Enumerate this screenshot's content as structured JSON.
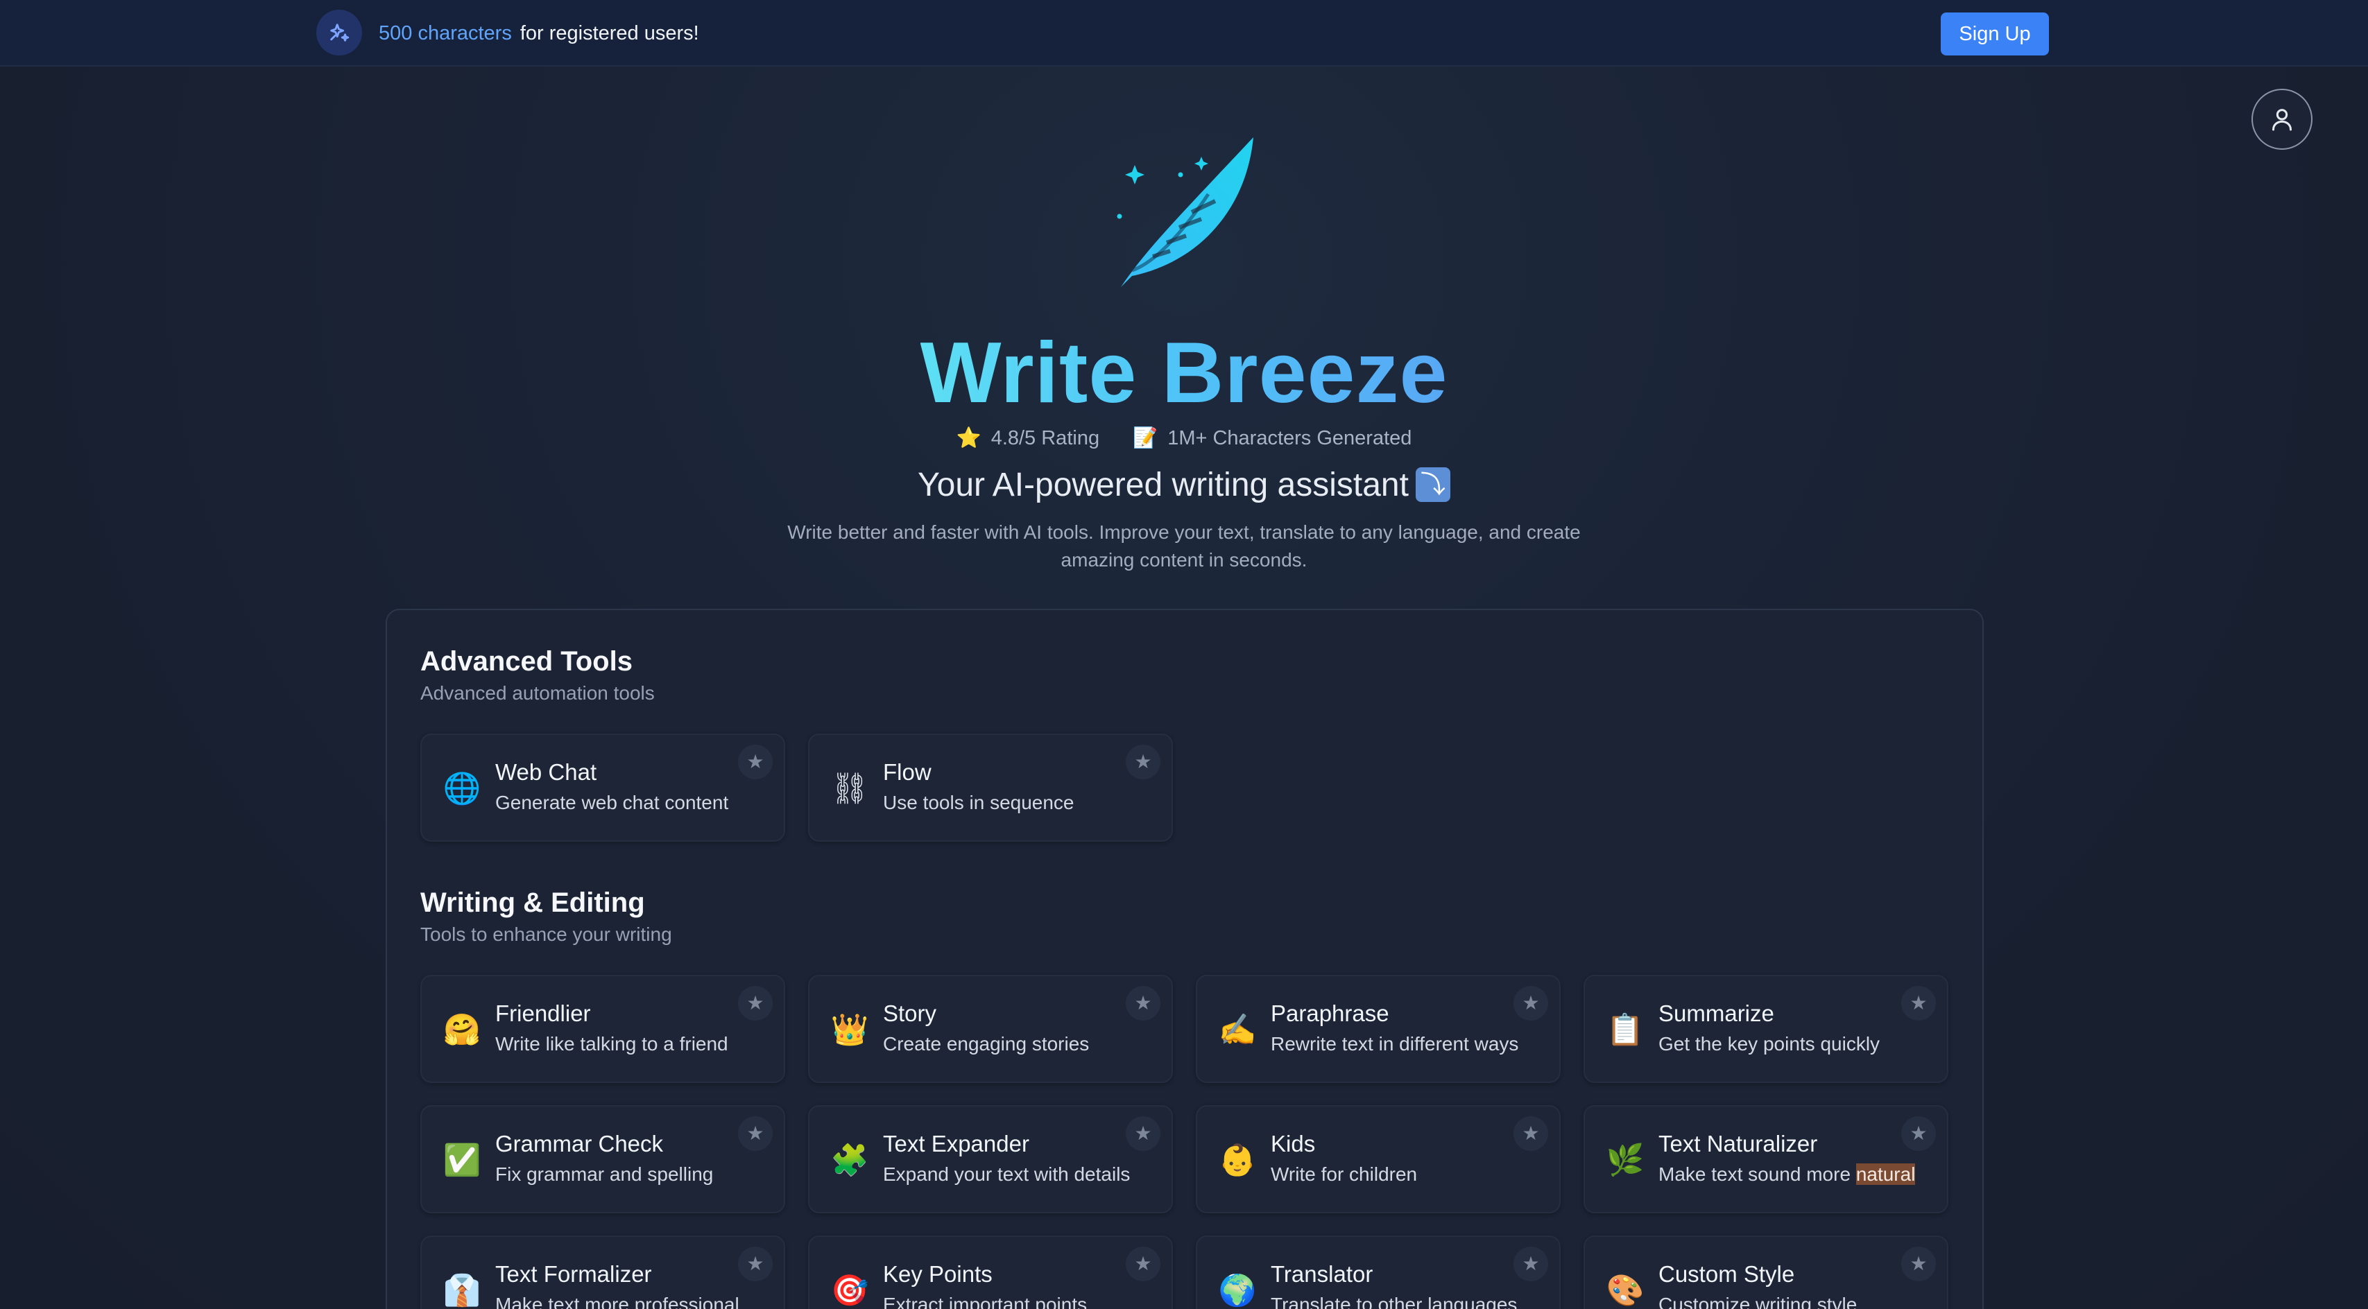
{
  "banner": {
    "highlight": "500 characters",
    "text": "for registered users!",
    "signup_label": "Sign Up",
    "icon": "sparkles-icon"
  },
  "user": {
    "icon": "user-icon"
  },
  "hero": {
    "brand": "Write Breeze",
    "rating_icon": "⭐",
    "rating": "4.8/5 Rating",
    "chars_icon": "📝",
    "chars": "1M+ Characters Generated",
    "tagline": "Your AI-powered writing assistant",
    "tagline_emoji": "⤵",
    "description": "Write better and faster with AI tools. Improve your text, translate to any language, and create amazing content in seconds."
  },
  "sections": {
    "advanced": {
      "title": "Advanced Tools",
      "subtitle": "Advanced automation tools",
      "tools": [
        {
          "icon": "🌐",
          "title": "Web Chat",
          "desc": "Generate web chat content"
        },
        {
          "icon": "⛓",
          "title": "Flow",
          "desc": "Use tools in sequence"
        }
      ]
    },
    "writing": {
      "title": "Writing & Editing",
      "subtitle": "Tools to enhance your writing",
      "tools": [
        {
          "icon": "🤗",
          "title": "Friendlier",
          "desc": "Write like talking to a friend"
        },
        {
          "icon": "👑",
          "title": "Story",
          "desc": "Create engaging stories"
        },
        {
          "icon": "✍",
          "title": "Paraphrase",
          "desc": "Rewrite text in different ways"
        },
        {
          "icon": "📋",
          "title": "Summarize",
          "desc": "Get the key points quickly"
        },
        {
          "icon": "✅",
          "title": "Grammar Check",
          "desc": "Fix grammar and spelling"
        },
        {
          "icon": "🧩",
          "title": "Text Expander",
          "desc": "Expand your text with details"
        },
        {
          "icon": "👶",
          "title": "Kids",
          "desc": "Write for children"
        },
        {
          "icon": "🌿",
          "title": "Text Naturalizer",
          "desc": "Make text sound more",
          "desc_highlight": "natural"
        },
        {
          "icon": "👔",
          "title": "Text Formalizer",
          "desc": "Make text more professional"
        },
        {
          "icon": "🎯",
          "title": "Key Points",
          "desc": "Extract important points"
        },
        {
          "icon": "🌍",
          "title": "Translator",
          "desc": "Translate to other languages"
        },
        {
          "icon": "🎨",
          "title": "Custom Style",
          "desc": "Customize writing style"
        }
      ]
    }
  },
  "star_glyph": "★"
}
